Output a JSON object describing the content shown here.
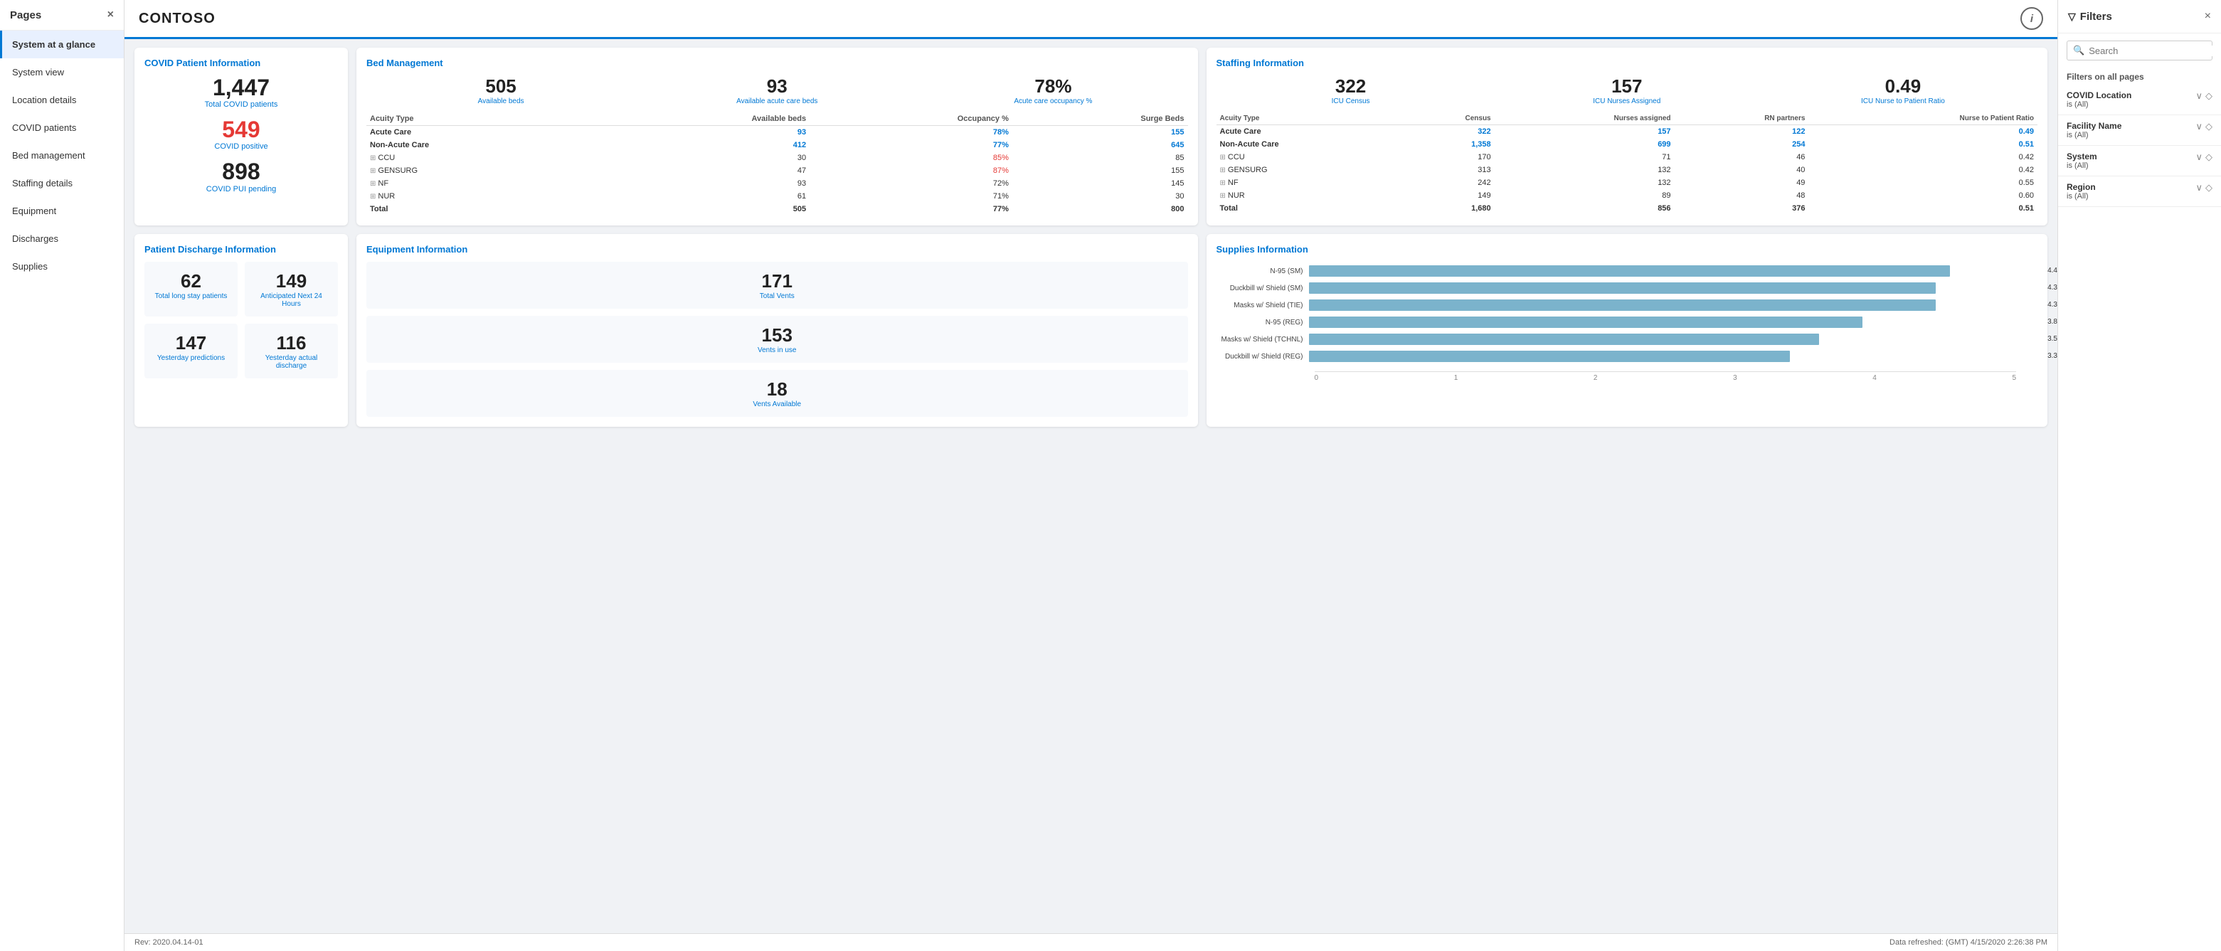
{
  "sidebar": {
    "header": "Pages",
    "close_icon": "×",
    "items": [
      {
        "label": "System at a glance",
        "active": true
      },
      {
        "label": "System view",
        "active": false
      },
      {
        "label": "Location details",
        "active": false
      },
      {
        "label": "COVID patients",
        "active": false
      },
      {
        "label": "Bed management",
        "active": false
      },
      {
        "label": "Staffing details",
        "active": false
      },
      {
        "label": "Equipment",
        "active": false
      },
      {
        "label": "Discharges",
        "active": false
      },
      {
        "label": "Supplies",
        "active": false
      }
    ]
  },
  "topbar": {
    "title": "CONTOSO",
    "info_icon": "i"
  },
  "covid": {
    "title": "COVID Patient Information",
    "total_number": "1,447",
    "total_label": "Total COVID patients",
    "positive_number": "549",
    "positive_label": "COVID positive",
    "pending_number": "898",
    "pending_label": "COVID PUI pending"
  },
  "bed": {
    "title": "Bed Management",
    "stats": [
      {
        "num": "505",
        "lbl": "Available beds"
      },
      {
        "num": "93",
        "lbl": "Available acute care beds"
      },
      {
        "num": "78%",
        "lbl": "Acute care occupancy %"
      }
    ],
    "table": {
      "headers": [
        "Acuity Type",
        "Available beds",
        "Occupancy %",
        "Surge Beds"
      ],
      "rows": [
        {
          "type": "Acute Care",
          "group": true,
          "avail": "93",
          "occ": "78%",
          "occ_warn": false,
          "surge": "155"
        },
        {
          "type": "Non-Acute Care",
          "group": true,
          "avail": "412",
          "occ": "77%",
          "occ_warn": false,
          "surge": "645"
        },
        {
          "type": "CCU",
          "group": false,
          "avail": "30",
          "occ": "85%",
          "occ_warn": true,
          "surge": "85"
        },
        {
          "type": "GENSURG",
          "group": false,
          "avail": "47",
          "occ": "87%",
          "occ_warn": true,
          "surge": "155"
        },
        {
          "type": "NF",
          "group": false,
          "avail": "93",
          "occ": "72%",
          "occ_warn": false,
          "surge": "145"
        },
        {
          "type": "NUR",
          "group": false,
          "avail": "61",
          "occ": "71%",
          "occ_warn": false,
          "surge": "30"
        }
      ],
      "total": {
        "avail": "505",
        "occ": "77%",
        "surge": "800"
      }
    }
  },
  "staffing": {
    "title": "Staffing Information",
    "stats": [
      {
        "num": "322",
        "lbl": "ICU Census"
      },
      {
        "num": "157",
        "lbl": "ICU Nurses Assigned"
      },
      {
        "num": "0.49",
        "lbl": "ICU Nurse to Patient Ratio"
      }
    ],
    "table": {
      "headers": [
        "Acuity Type",
        "Census",
        "Nurses assigned",
        "RN partners",
        "Nurse to Patient Ratio"
      ],
      "rows": [
        {
          "type": "Acute Care",
          "group": true,
          "census": "322",
          "nurses": "157",
          "rn": "122",
          "ratio": "0.49"
        },
        {
          "type": "Non-Acute Care",
          "group": true,
          "census": "1,358",
          "nurses": "699",
          "rn": "254",
          "ratio": "0.51"
        },
        {
          "type": "CCU",
          "group": false,
          "census": "170",
          "nurses": "71",
          "rn": "46",
          "ratio": "0.42"
        },
        {
          "type": "GENSURG",
          "group": false,
          "census": "313",
          "nurses": "132",
          "rn": "40",
          "ratio": "0.42"
        },
        {
          "type": "NF",
          "group": false,
          "census": "242",
          "nurses": "132",
          "rn": "49",
          "ratio": "0.55"
        },
        {
          "type": "NUR",
          "group": false,
          "census": "149",
          "nurses": "89",
          "rn": "48",
          "ratio": "0.60"
        }
      ],
      "total": {
        "census": "1,680",
        "nurses": "856",
        "rn": "376",
        "ratio": "0.51"
      }
    }
  },
  "discharge": {
    "title": "Patient Discharge Information",
    "stats": [
      {
        "num": "62",
        "lbl": "Total long stay patients"
      },
      {
        "num": "149",
        "lbl": "Anticipated Next 24 Hours"
      },
      {
        "num": "147",
        "lbl": "Yesterday predictions"
      },
      {
        "num": "116",
        "lbl": "Yesterday actual discharge"
      }
    ]
  },
  "equipment": {
    "title": "Equipment Information",
    "stats": [
      {
        "num": "171",
        "lbl": "Total Vents"
      },
      {
        "num": "153",
        "lbl": "Vents in use"
      },
      {
        "num": "18",
        "lbl": "Vents Available"
      }
    ]
  },
  "supplies": {
    "title": "Supplies Information",
    "max_value": 5,
    "axis_labels": [
      "0",
      "1",
      "2",
      "3",
      "4",
      "5"
    ],
    "items": [
      {
        "label": "N-95 (SM)",
        "value": 4.4
      },
      {
        "label": "Duckbill w/ Shield (SM)",
        "value": 4.3
      },
      {
        "label": "Masks w/ Shield (TIE)",
        "value": 4.3
      },
      {
        "label": "N-95 (REG)",
        "value": 3.8
      },
      {
        "label": "Masks w/ Shield (TCHNL)",
        "value": 3.5
      },
      {
        "label": "Duckbill w/ Shield (REG)",
        "value": 3.3
      }
    ]
  },
  "footer": {
    "rev": "Rev: 2020.04.14-01",
    "refresh": "Data refreshed: (GMT)",
    "timestamp": "4/15/2020 2:26:38 PM"
  },
  "filters": {
    "title": "Filters",
    "search_placeholder": "Search",
    "section_label": "Filters on all pages",
    "filter_icon": "▽",
    "items": [
      {
        "name": "COVID Location",
        "value": "is (All)"
      },
      {
        "name": "Facility Name",
        "value": "is (All)"
      },
      {
        "name": "System",
        "value": "is (All)"
      },
      {
        "name": "Region",
        "value": "is (All)"
      }
    ]
  }
}
